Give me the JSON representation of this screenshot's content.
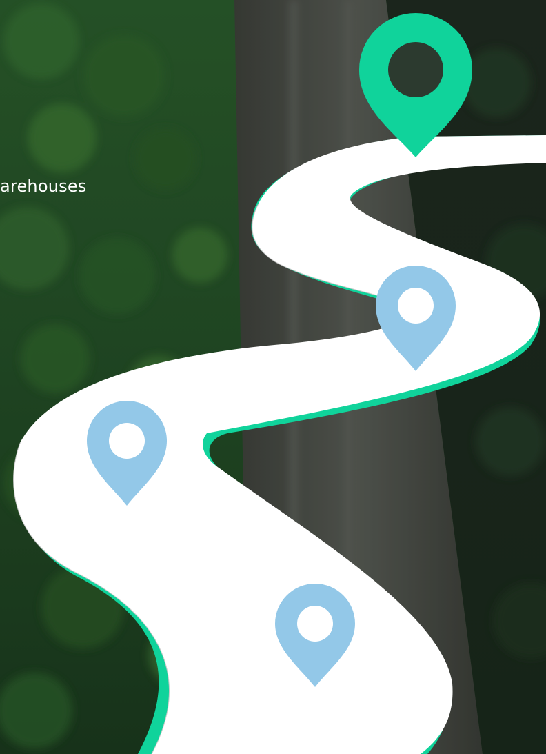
{
  "caption": {
    "text": "arehouses"
  },
  "colors": {
    "accent": "#10d39b",
    "pin_primary": "#10d39b",
    "pin_secondary": "#93c8e8",
    "road": "#ffffff",
    "foliage_dark": "#1e4224",
    "foliage_light": "#3f7a35",
    "asphalt": "#4c5048"
  },
  "icons": {
    "start_pin": "map-pin-icon",
    "stop_pin": "map-pin-icon"
  }
}
